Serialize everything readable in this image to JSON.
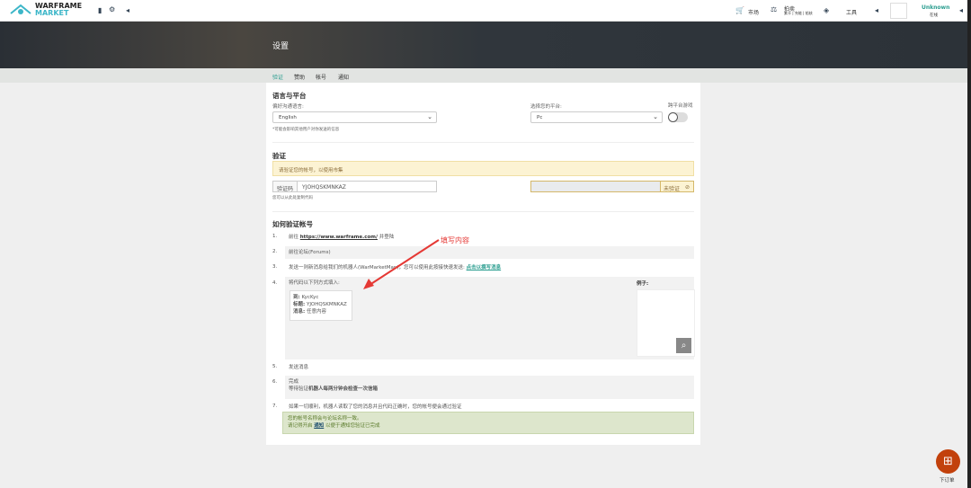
{
  "nav": {
    "logo_top": "WARFRAME",
    "logo_bottom": "MARKET",
    "market": "市场",
    "auction": "拍卖",
    "auction_sub": "紫卡 | 充能 | 船核",
    "tools": "工具",
    "user": "Unknown",
    "user_status": "在线"
  },
  "page": {
    "title": "设置"
  },
  "tabs": [
    "验证",
    "赞助",
    "帐号",
    "通知"
  ],
  "lang": {
    "heading": "语言与平台",
    "pref_label": "偏好沟通语言:",
    "pref_value": "English",
    "pref_note": "*可能会影响其他用户对你发送的信息",
    "platform_label": "选择您的平台:",
    "platform_value": "Pc",
    "crossplay_label": "跨平台游戏"
  },
  "verify": {
    "heading": "验证",
    "warning": "请验证您的帐号，以使用市集",
    "code_label": "验证码",
    "code_value": "YJOHQSKMNKAZ",
    "code_note": "您可以从此处复制代码",
    "status": "未验证"
  },
  "howto": {
    "heading": "如何验证帐号",
    "annotation": "填写内容",
    "example": "例子:",
    "steps": [
      {
        "n": "1.",
        "pre": "前往 ",
        "link": "https://www.warframe.com/",
        "post": " 并登陆"
      },
      {
        "n": "2.",
        "text": "前往论坛(Forums)"
      },
      {
        "n": "3.",
        "pre": "发送一则新消息给我们的机器人(WarMarketMan)，您可以使用此按接快速发送: ",
        "link": "点击以撰写消息"
      },
      {
        "n": "4.",
        "text": "将代码以下列方式填入:",
        "to_label": "到:",
        "to": "KycKyc",
        "subject_label": "标题:",
        "subject": "YJOHQSKMNKAZ",
        "msg_label": "消息:",
        "msg": "任意内容"
      },
      {
        "n": "5.",
        "text": "发送消息"
      },
      {
        "n": "6.",
        "line1": "完成",
        "pre": "等待验证",
        "bold": "机器人每两分钟会检查一次信箱"
      },
      {
        "n": "7.",
        "text": "如果一切顺利，机器人读取了您的消息并且代码正确时，您的帐号便会通过验证",
        "g1": "您的帐号名称会与论坛名称一致。",
        "g2pre": "请记得开启 ",
        "g2link": "通知",
        "g2post": " 以便于通知您验证已完成"
      }
    ]
  },
  "fab": {
    "label": "下订单"
  }
}
